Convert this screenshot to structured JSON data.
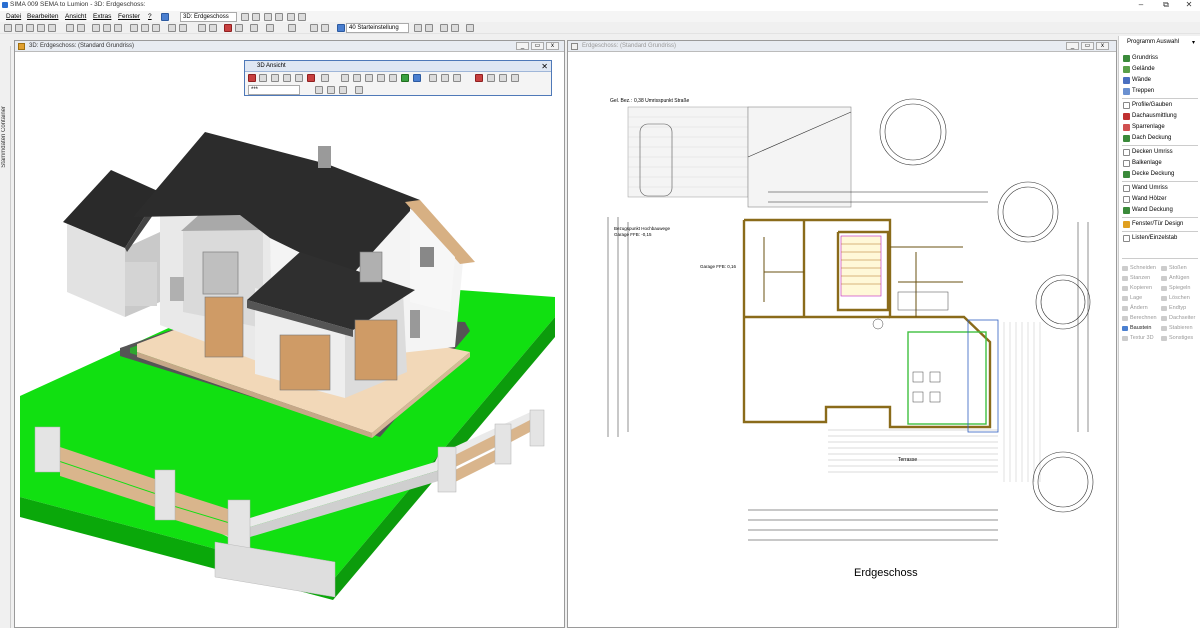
{
  "window": {
    "title": "SIMA 009 SEMA to Lumion - 3D: Erdgeschoss:",
    "minimize": "–",
    "maximize": "⧉",
    "close": "✕"
  },
  "menu": [
    "Datei",
    "Bearbeiten",
    "Ansicht",
    "Extras",
    "Fenster",
    "?"
  ],
  "toolbar": {
    "view_combo": "3D: Erdgeschoss",
    "preset_combo": "40 Starteinstellung"
  },
  "left_sidebar": {
    "label": "Stammdaten Container"
  },
  "pane3d": {
    "title": "3D: Erdgeschoss: (Standard Grundriss)"
  },
  "floatbar": {
    "title": "3D Ansicht",
    "field": "***"
  },
  "paneplan": {
    "title": "Erdgeschoss: (Standard Grundriss)",
    "label_gel": "Gel. Bez.:",
    "label_gel_val": "0,38 Umrisspunkt Straße",
    "label_ref": "Bezugspunkt Hochbauwege",
    "label_ref2": "Garage FFB: -0,15",
    "label_garage": "Garage FFB: 0,16",
    "label_terrasse": "Terrasse",
    "floor_name": "Erdgeschoss"
  },
  "right_panel": {
    "header": "Programm Auswahl",
    "group1": [
      "Grundriss",
      "Gelände",
      "Wände",
      "Treppen"
    ],
    "group2": [
      "Profile/Gauben",
      "Dachausmittlung",
      "Sparrenlage",
      "Dach Deckung"
    ],
    "group3": [
      "Decken Umriss",
      "Balkenlage",
      "Decke Deckung"
    ],
    "group4": [
      "Wand Umriss",
      "Wand Hölzer",
      "Wand Deckung"
    ],
    "group5": [
      "Fenster/Tür Design"
    ],
    "group6": [
      "Listen/Einzelstab"
    ],
    "tools_left": [
      "Schneiden",
      "Stanzen",
      "Kopieren",
      "Lage",
      "Ändern",
      "Berechnen",
      "Baustein",
      "Textur 3D"
    ],
    "tools_right": [
      "Stoßen",
      "Anfügen",
      "Spiegeln",
      "Löschen",
      "Endtyp",
      "Dachseiter",
      "Stabieren",
      "Sonstiges"
    ],
    "colors": {
      "grundriss": "#3a8a3a",
      "gelaende": "#5aa04a",
      "waende": "#4a6fc0",
      "treppen": "#6a90d0",
      "dach": "#c03030",
      "decke": "#d08020",
      "wand": "#3a8a3a",
      "fenster": "#e0a020"
    }
  }
}
